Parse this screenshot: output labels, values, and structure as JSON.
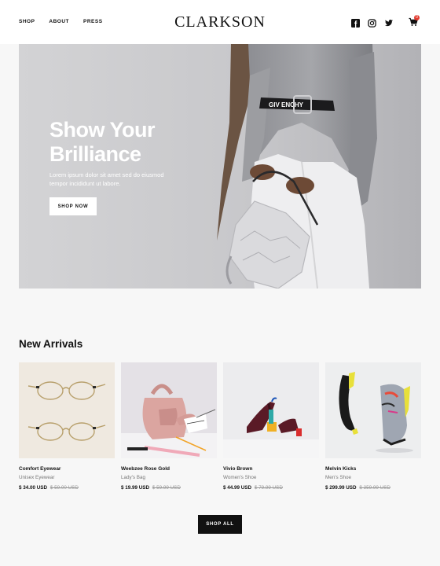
{
  "header": {
    "nav": [
      "SHOP",
      "ABOUT",
      "PRESS"
    ],
    "logo": "CLARKSON",
    "social_icons": [
      "facebook-icon",
      "instagram-icon",
      "twitter-icon"
    ],
    "cart_icon": "cart-icon",
    "cart_count": "0"
  },
  "hero": {
    "title_line1": "Show Your",
    "title_line2": "Brilliance",
    "subtitle": "Lorem ipsum dolor sit amet sed do eiusmod tempor incididunt ut labore.",
    "button": "SHOP NOW",
    "belt_text": "GIV    ENCHY"
  },
  "new_arrivals": {
    "title": "New Arrivals",
    "products": [
      {
        "name": "Comfort Eyewear",
        "category": "Unisex Eyewear",
        "price": "$ 34.00 USD",
        "old_price": "$ 59.00 USD"
      },
      {
        "name": "Weebzee Rose Gold",
        "category": "Lady's Bag",
        "price": "$ 19.99 USD",
        "old_price": "$ 59.99 USD"
      },
      {
        "name": "Vivio Brown",
        "category": "Women's Shoe",
        "price": "$ 44.99 USD",
        "old_price": "$ 79.99 USD"
      },
      {
        "name": "Melvin Kicks",
        "category": "Men's Shoe",
        "price": "$ 299.99 USD",
        "old_price": "$ 359.99 USD"
      }
    ],
    "shop_all": "SHOP ALL"
  },
  "colors": {
    "background": "#f7f7f7",
    "text": "#111111",
    "muted": "#777777",
    "badge": "#e23b2f"
  }
}
